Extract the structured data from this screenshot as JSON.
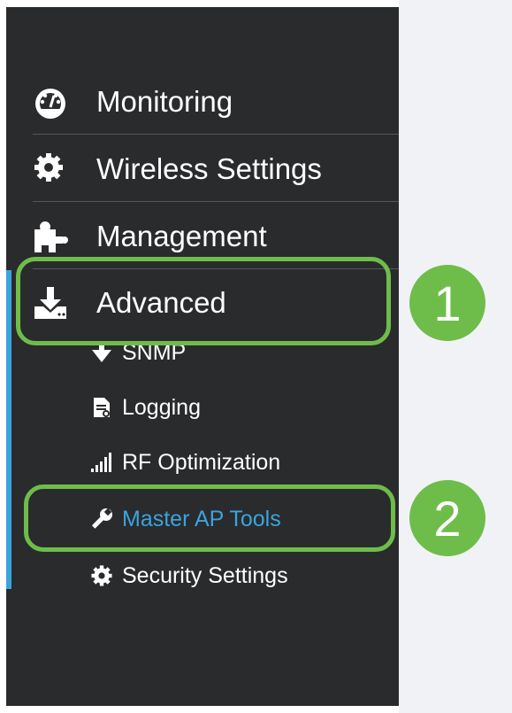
{
  "sidebar": {
    "items": [
      {
        "label": "Monitoring",
        "icon": "dashboard-icon"
      },
      {
        "label": "Wireless Settings",
        "icon": "gear-icon"
      },
      {
        "label": "Management",
        "icon": "puzzle-icon"
      },
      {
        "label": "Advanced",
        "icon": "download-tray-icon"
      }
    ],
    "subitems": [
      {
        "label": "SNMP",
        "icon": "down-arrow-icon"
      },
      {
        "label": "Logging",
        "icon": "document-icon"
      },
      {
        "label": "RF Optimization",
        "icon": "signal-bars-icon"
      },
      {
        "label": "Master AP Tools",
        "icon": "wrench-icon",
        "active": true
      },
      {
        "label": "Security Settings",
        "icon": "gear-icon"
      }
    ]
  },
  "annotations": {
    "step1": "1",
    "step2": "2"
  },
  "colors": {
    "sidebar_bg": "#2a2b2d",
    "accent": "#3aa4dd",
    "annotation": "#6ebd4a"
  }
}
